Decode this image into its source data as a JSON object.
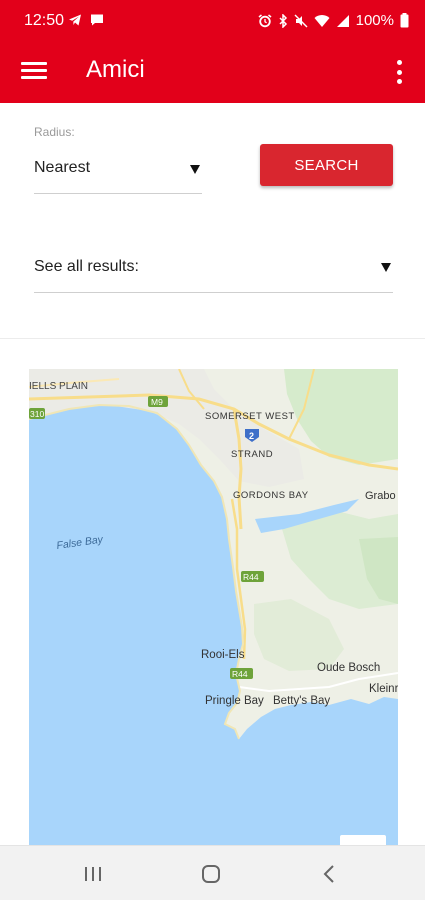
{
  "status_bar": {
    "time": "12:50",
    "battery": "100%",
    "left_icons": [
      "telegram-icon",
      "message-icon"
    ],
    "right_icons": [
      "alarm-icon",
      "bluetooth-icon",
      "mute-icon",
      "wifi-icon",
      "signal-icon",
      "battery-icon"
    ]
  },
  "app_bar": {
    "title": "Amici",
    "menu_icon": "menu-icon",
    "overflow_icon": "more-vert-icon",
    "color": "#e2001a"
  },
  "form": {
    "radius_label": "Radius:",
    "radius_value": "Nearest",
    "search_label": "SEARCH",
    "results_label": "See all results:"
  },
  "map": {
    "labels": {
      "mitchells_plain": "IELLS PLAIN",
      "somerset_west": "SOMERSET WEST",
      "strand": "STRAND",
      "gordons_bay": "GORDONS BAY",
      "grabouw": "Grabo",
      "false_bay": "False Bay",
      "rooi_els": "Rooi-Els",
      "oude_bosch": "Oude Bosch",
      "kleinmond": "Kleinr",
      "pringle_bay": "Pringle Bay",
      "bettys_bay": "Betty's Bay"
    },
    "road_shields": {
      "m9": "M9",
      "r310": "310",
      "r44_a": "R44",
      "r44_b": "R44",
      "n2": "2"
    },
    "colors": {
      "water": "#a8d5fb",
      "land": "#eef0e6",
      "green": "#d6ebcc",
      "road": "#f8dd8a"
    }
  },
  "nav_bar": {
    "icons": [
      "recent-apps-icon",
      "home-icon",
      "back-icon"
    ]
  }
}
